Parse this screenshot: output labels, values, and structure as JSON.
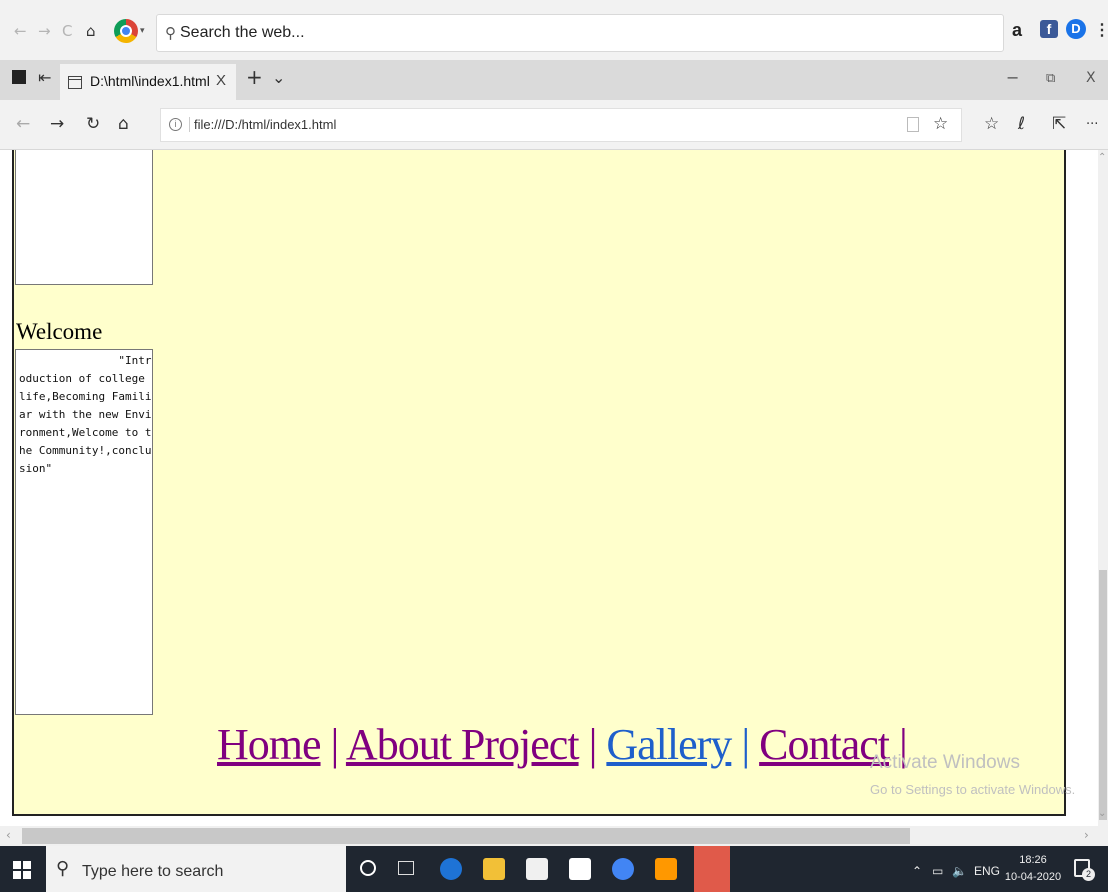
{
  "outer_toolbar": {
    "search_placeholder": "Search the web...",
    "nav_symbols": [
      "←",
      "→",
      "C",
      "⌂"
    ],
    "menu_dots": "⋮"
  },
  "tab_bar": {
    "tab_title": "D:\\html\\index1.html",
    "tab_close": "X",
    "new_tab": "+",
    "tab_list": "⌄",
    "minimize": "−",
    "restore": "⧉",
    "close": "X"
  },
  "address_bar": {
    "url": "file:///D:/html/index1.html",
    "back": "←",
    "forward": "→",
    "refresh": "↻",
    "home": "⌂",
    "more": "···"
  },
  "page": {
    "welcome": "Welcome",
    "intro_text": "               \"Introduction of college life,Becoming Familiar with the new Environment,Welcome to the Community!,conclusion\"",
    "nav": {
      "home": "Home",
      "sep": "|",
      "about": "About Project",
      "gallery": "Gallery",
      "contact": "Contact"
    },
    "page_background": "#ffffcc",
    "link_color": "#800080",
    "gallery_color": "#1e5fcb"
  },
  "watermark": {
    "line1": "Activate Windows",
    "line2": "Go to Settings to activate Windows."
  },
  "taskbar": {
    "search_placeholder": "Type here to search",
    "language": "ENG",
    "time": "18:26",
    "date": "10-04-2020",
    "notification_count": "2"
  }
}
